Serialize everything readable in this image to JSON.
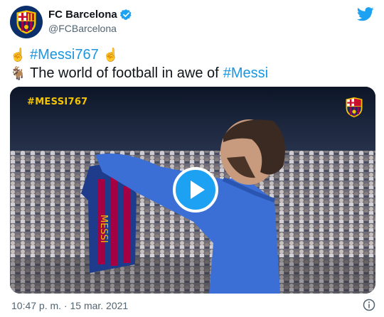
{
  "author": {
    "display_name": "FC Barcelona",
    "handle": "@FCBarcelona",
    "verified": true
  },
  "tweet": {
    "line1": {
      "emoji_left": "☝️",
      "hashtag": "#Messi767",
      "emoji_right": "☝️"
    },
    "line2": {
      "emoji": "🐐",
      "text": "The world of football in awe of",
      "hashtag": "#Messi"
    }
  },
  "media": {
    "overlay_tag": "#MESSI767",
    "type": "video",
    "play_icon": "play-icon"
  },
  "footer": {
    "timestamp": "10:47 p. m. · 15 mar. 2021"
  },
  "icons": {
    "brand": "twitter-bird-icon",
    "info": "info-icon"
  },
  "colors": {
    "accent": "#1da1f2",
    "hashtag": "#1b95e0",
    "muted": "#536471",
    "tag_yellow": "#f5c400"
  }
}
